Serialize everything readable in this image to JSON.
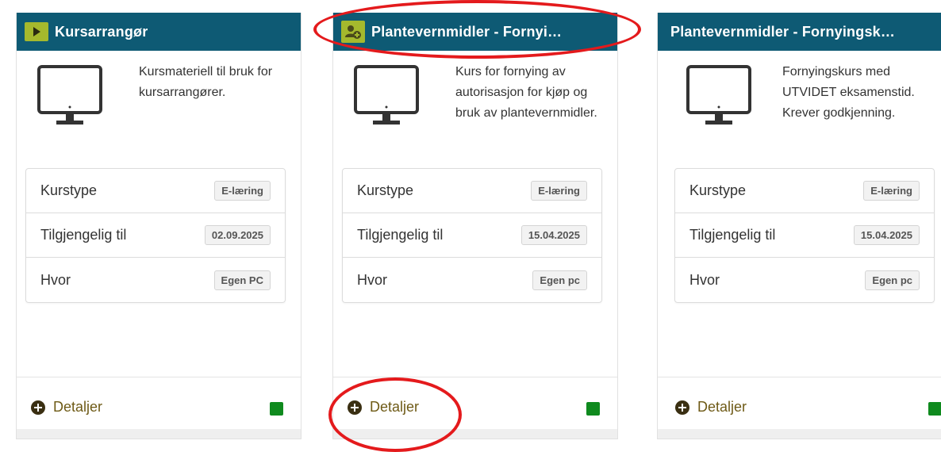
{
  "top_text": "",
  "cards": [
    {
      "title": "Kursarrangør",
      "icon": "play-badge-icon",
      "description": "Kursmateriell til bruk for kursarrangører.",
      "rows": [
        {
          "label": "Kurstype",
          "value": "E-læring"
        },
        {
          "label": "Tilgjengelig til",
          "value": "02.09.2025"
        },
        {
          "label": "Hvor",
          "value": "Egen PC"
        }
      ],
      "details_label": "Detaljer"
    },
    {
      "title": "Plantevernmidler - Fornyi…",
      "icon": "user-add-badge-icon",
      "description": "Kurs for fornying av autorisasjon for kjøp og bruk av plantevernmidler.",
      "rows": [
        {
          "label": "Kurstype",
          "value": "E-læring"
        },
        {
          "label": "Tilgjengelig til",
          "value": "15.04.2025"
        },
        {
          "label": "Hvor",
          "value": "Egen pc"
        }
      ],
      "details_label": "Detaljer"
    },
    {
      "title": "Plantevernmidler - Fornyingsk…",
      "icon": "",
      "description": "Fornyingskurs med UTVIDET eksamenstid. Krever godkjenning.",
      "rows": [
        {
          "label": "Kurstype",
          "value": "E-læring"
        },
        {
          "label": "Tilgjengelig til",
          "value": "15.04.2025"
        },
        {
          "label": "Hvor",
          "value": "Egen pc"
        }
      ],
      "details_label": "Detaljer"
    }
  ],
  "colors": {
    "header": "#0e5a74",
    "badge": "#a5b92d",
    "status": "#0f8a1e",
    "link": "#6e5a16",
    "annotation": "#e41a1c"
  }
}
